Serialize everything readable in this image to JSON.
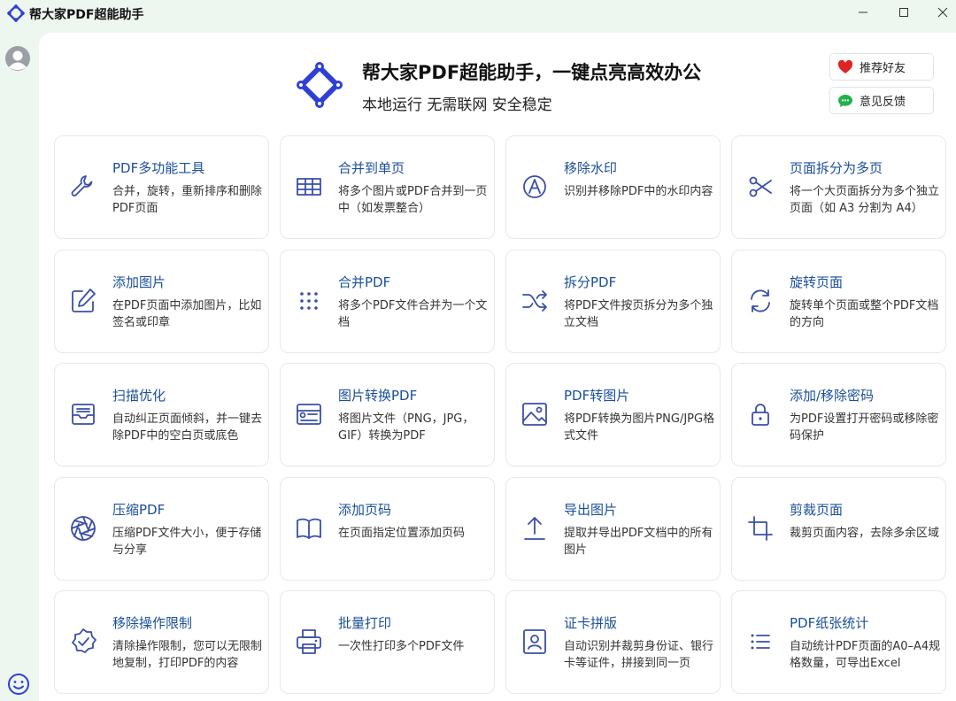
{
  "window": {
    "title": "帮大家PDF超能助手"
  },
  "header": {
    "title": "帮大家PDF超能助手，一键点亮高效办公",
    "subtitle": "本地运行 无需联网 安全稳定"
  },
  "actions": {
    "recommend": "推荐好友",
    "feedback": "意见反馈"
  },
  "colors": {
    "brand": "#2f3fd6",
    "title_blue": "#1a4f9a",
    "icon": "#3a4fa8"
  },
  "tools": [
    {
      "title": "PDF多功能工具",
      "desc": "合并，旋转，重新排序和删除PDF页面",
      "icon": "wrench-icon"
    },
    {
      "title": "合并到单页",
      "desc": "将多个图片或PDF合并到一页中（如发票整合）",
      "icon": "table-icon"
    },
    {
      "title": "移除水印",
      "desc": "识别并移除PDF中的水印内容",
      "icon": "watermark-icon"
    },
    {
      "title": "页面拆分为多页",
      "desc": "将一个大页面拆分为多个独立页面（如 A3 分割为 A4）",
      "icon": "scissors-icon"
    },
    {
      "title": "添加图片",
      "desc": "在PDF页面中添加图片，比如签名或印章",
      "icon": "edit-icon"
    },
    {
      "title": "合并PDF",
      "desc": "将多个PDF文件合并为一个文档",
      "icon": "grid-dots-icon"
    },
    {
      "title": "拆分PDF",
      "desc": "将PDF文件按页拆分为多个独立文档",
      "icon": "shuffle-icon"
    },
    {
      "title": "旋转页面",
      "desc": "旋转单个页面或整个PDF文档的方向",
      "icon": "rotate-icon"
    },
    {
      "title": "扫描优化",
      "desc": "自动纠正页面倾斜，并一键去除PDF中的空白页或底色",
      "icon": "inbox-icon"
    },
    {
      "title": "图片转换PDF",
      "desc": "将图片文件（PNG，JPG，GIF）转换为PDF",
      "icon": "image-card-icon"
    },
    {
      "title": "PDF转图片",
      "desc": "将PDF转换为图片PNG/JPG格式文件",
      "icon": "picture-icon"
    },
    {
      "title": "添加/移除密码",
      "desc": "为PDF设置打开密码或移除密码保护",
      "icon": "lock-icon"
    },
    {
      "title": "压缩PDF",
      "desc": "压缩PDF文件大小，便于存储与分享",
      "icon": "aperture-icon"
    },
    {
      "title": "添加页码",
      "desc": "在页面指定位置添加页码",
      "icon": "book-icon"
    },
    {
      "title": "导出图片",
      "desc": "提取并导出PDF文档中的所有图片",
      "icon": "upload-icon"
    },
    {
      "title": "剪裁页面",
      "desc": "裁剪页面内容，去除多余区域",
      "icon": "crop-icon"
    },
    {
      "title": "移除操作限制",
      "desc": "清除操作限制，您可以无限制地复制，打印PDF的内容",
      "icon": "badge-check-icon"
    },
    {
      "title": "批量打印",
      "desc": "一次性打印多个PDF文件",
      "icon": "printer-icon"
    },
    {
      "title": "证卡拼版",
      "desc": "自动识别并裁剪身份证、银行卡等证件，拼接到同一页",
      "icon": "id-card-icon"
    },
    {
      "title": "PDF纸张统计",
      "desc": "自动统计PDF页面的A0–A4规格数量，可导出Excel",
      "icon": "list-icon"
    }
  ]
}
